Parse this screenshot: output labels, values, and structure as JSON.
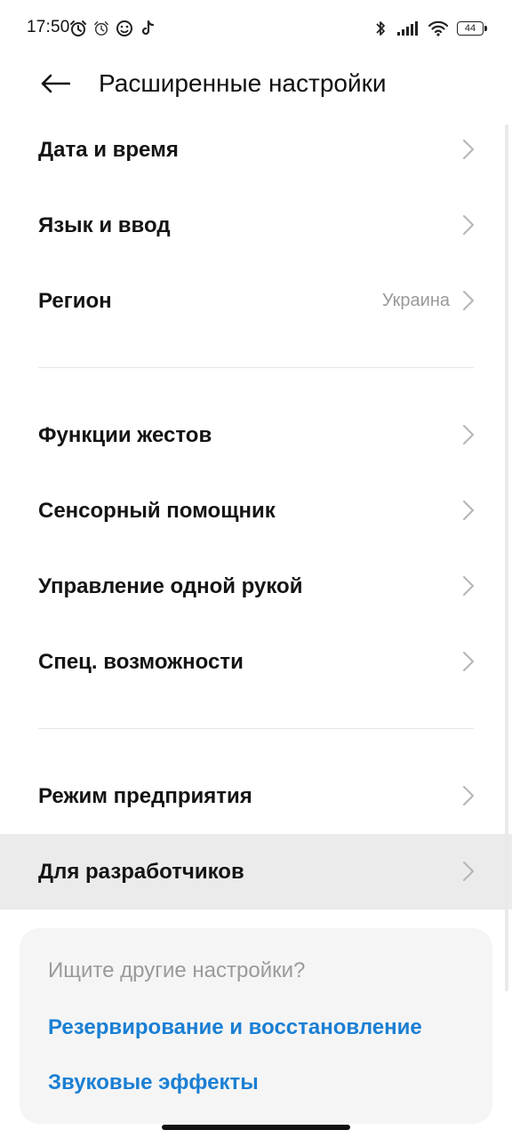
{
  "status_bar": {
    "time": "17:50",
    "battery": "44",
    "left_icons": [
      "alarm-icon",
      "alarm-icon",
      "emoji-app-icon",
      "tiktok-icon"
    ],
    "right_icons": [
      "bluetooth-icon",
      "signal-icon",
      "wifi-icon",
      "battery-icon"
    ]
  },
  "header": {
    "title": "Расширенные настройки"
  },
  "sections": [
    {
      "items": [
        {
          "label": "Дата и время",
          "value": ""
        },
        {
          "label": "Язык и ввод",
          "value": ""
        },
        {
          "label": "Регион",
          "value": "Украина"
        }
      ]
    },
    {
      "items": [
        {
          "label": "Функции жестов",
          "value": ""
        },
        {
          "label": "Сенсорный помощник",
          "value": ""
        },
        {
          "label": "Управление одной рукой",
          "value": ""
        },
        {
          "label": "Спец. возможности",
          "value": ""
        }
      ]
    },
    {
      "items": [
        {
          "label": "Режим предприятия",
          "value": ""
        },
        {
          "label": "Для разработчиков",
          "value": ""
        }
      ]
    }
  ],
  "suggestions": {
    "title": "Ищите другие настройки?",
    "links": [
      "Резервирование и восстановление",
      "Звуковые эффекты"
    ]
  },
  "colors": {
    "accent_link": "#1a7fd4",
    "highlight_row": "#ebebeb",
    "secondary_text": "#999999"
  }
}
